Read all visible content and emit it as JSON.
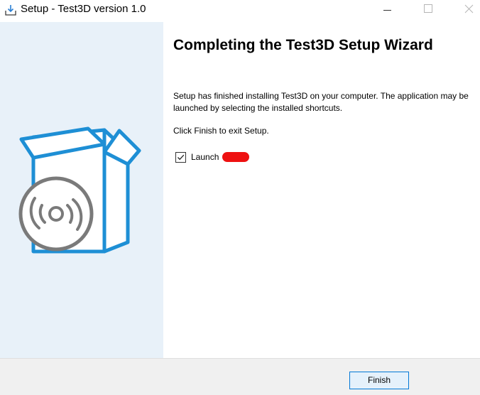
{
  "window": {
    "title": "Setup - Test3D version 1.0"
  },
  "content": {
    "heading": "Completing the Test3D Setup Wizard",
    "description": "Setup has finished installing Test3D on your computer. The application may be launched by selecting the installed shortcuts.",
    "exit_instruction": "Click Finish to exit Setup.",
    "launch_checkbox": {
      "label": "Launch",
      "checked": true
    }
  },
  "footer": {
    "finish_label": "Finish"
  },
  "colors": {
    "banner_background": "#e8f1f9",
    "accent_blue": "#1e8fd5",
    "disc_gray": "#7a7a7a",
    "button_border": "#0078d7",
    "redaction": "#ee1111"
  },
  "icons": {
    "app": "installer-download-icon",
    "banner": "software-box-with-disc-icon"
  }
}
